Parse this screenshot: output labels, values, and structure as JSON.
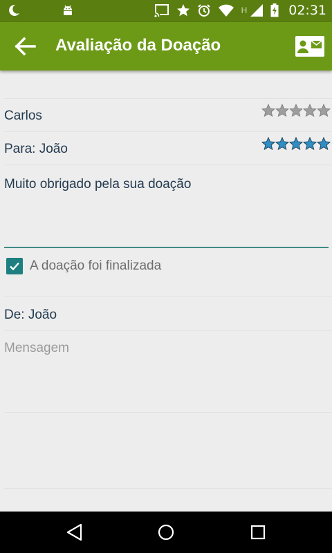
{
  "status_bar": {
    "time": "02:31",
    "network_letter": "H",
    "icons": [
      "moon-icon",
      "android-icon",
      "cast-icon",
      "star-icon",
      "alarm-icon",
      "wifi-icon",
      "signal-icon",
      "battery-charging-icon"
    ]
  },
  "toolbar": {
    "title": "Avaliação da Doação",
    "back_icon": "arrow-left-icon",
    "action_icon": "contact-card-icon",
    "color": "#6c9a16"
  },
  "rating_rows": [
    {
      "label": "Carlos",
      "stars_filled": 0,
      "stars_total": 5,
      "star_color": "#9e9e9e"
    },
    {
      "label": "Para:  João",
      "stars_filled": 5,
      "stars_total": 5,
      "star_color": "#2f8ec4"
    }
  ],
  "message": "Muito obrigado pela sua doação",
  "checkbox": {
    "label": "A doação foi finalizada",
    "checked": true,
    "color": "#1e7f80"
  },
  "reply": {
    "from_label": "De:  João",
    "message_placeholder": "Mensagem"
  },
  "nav_bar": {
    "buttons": [
      "back-triangle-icon",
      "home-circle-icon",
      "recents-square-icon"
    ]
  }
}
